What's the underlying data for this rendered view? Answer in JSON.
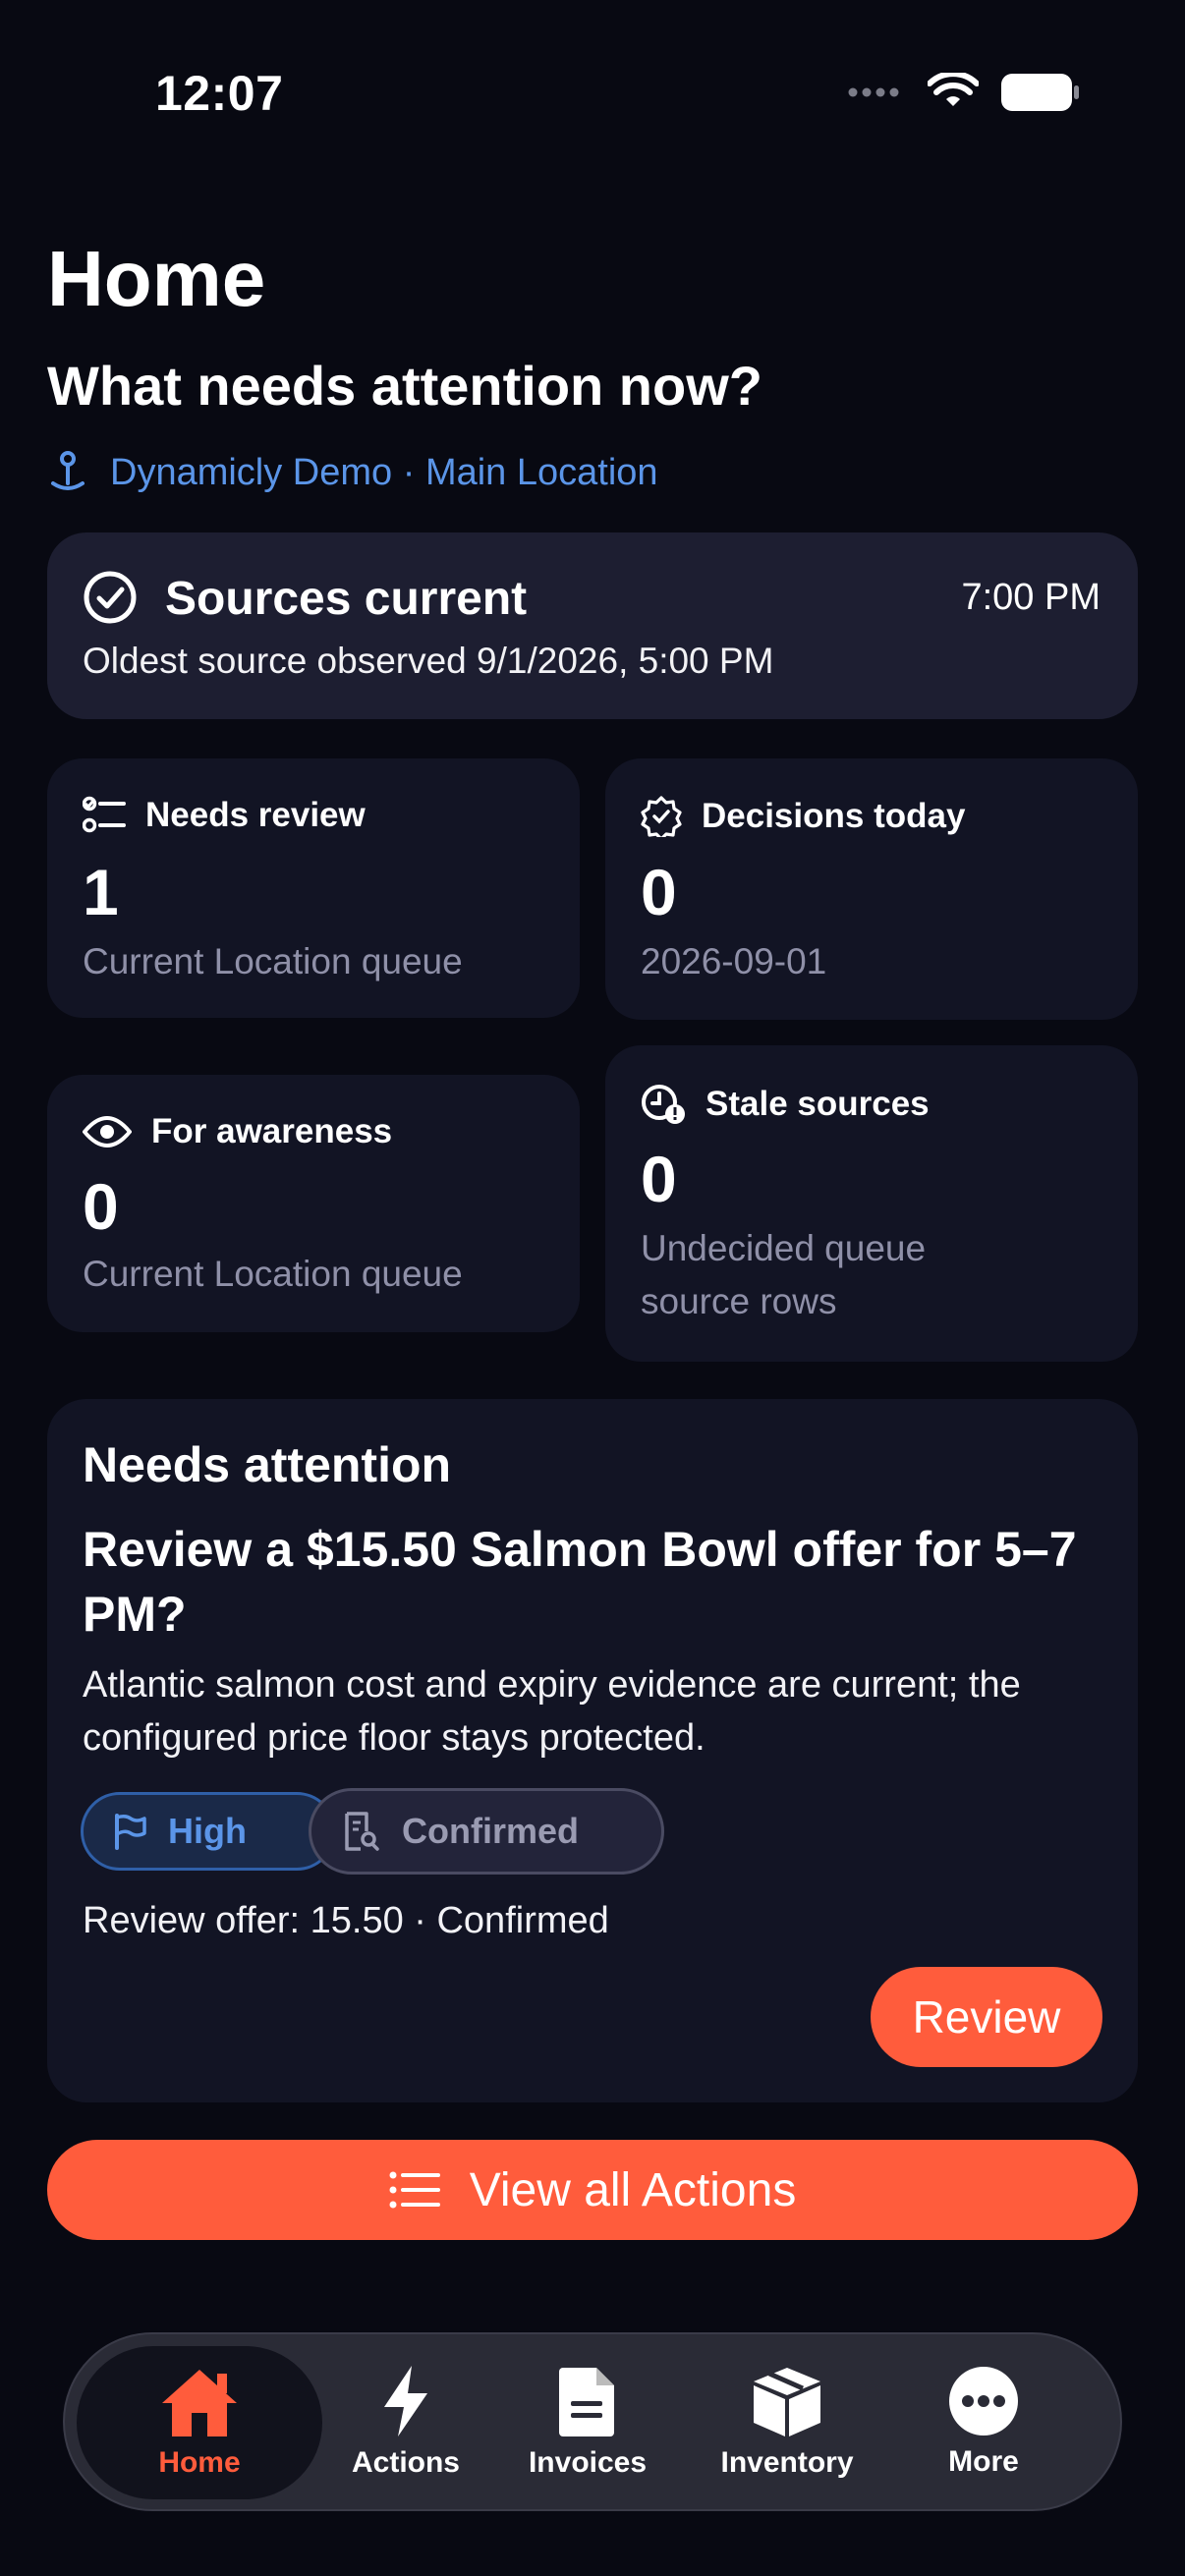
{
  "status_bar": {
    "time": "12:07"
  },
  "header": {
    "title": "Home",
    "subtitle": "What needs attention now?",
    "location": "Dynamicly Demo · Main Location"
  },
  "sources_card": {
    "title": "Sources current",
    "time": "7:00 PM",
    "subtitle": "Oldest source observed 9/1/2026, 5:00 PM"
  },
  "stats": {
    "needs_review": {
      "label": "Needs review",
      "value": "1",
      "desc": "Current Location queue"
    },
    "decisions_today": {
      "label": "Decisions today",
      "value": "0",
      "desc": "2026-09-01"
    },
    "for_awareness": {
      "label": "For awareness",
      "value": "0",
      "desc": "Current Location queue"
    },
    "stale_sources": {
      "label": "Stale sources",
      "value": "0",
      "desc": "Undecided queue source rows"
    }
  },
  "attention": {
    "heading": "Needs attention",
    "question": "Review a $15.50 Salmon Bowl offer for 5–7 PM?",
    "body": "Atlantic salmon cost and expiry evidence are current; the configured price floor stays protected.",
    "chip_priority": "High",
    "chip_status": "Confirmed",
    "meta": "Review offer: 15.50 · Confirmed",
    "review_label": "Review"
  },
  "view_all_label": "View all Actions",
  "tabs": [
    {
      "label": "Home",
      "icon": "home-icon",
      "active": true
    },
    {
      "label": "Actions",
      "icon": "bolt-icon",
      "active": false
    },
    {
      "label": "Invoices",
      "icon": "document-icon",
      "active": false
    },
    {
      "label": "Inventory",
      "icon": "box-icon",
      "active": false
    },
    {
      "label": "More",
      "icon": "more-icon",
      "active": false
    }
  ],
  "colors": {
    "accent": "#ff5c3c",
    "link": "#5b95e8",
    "background": "#080912",
    "card": "#121424"
  }
}
